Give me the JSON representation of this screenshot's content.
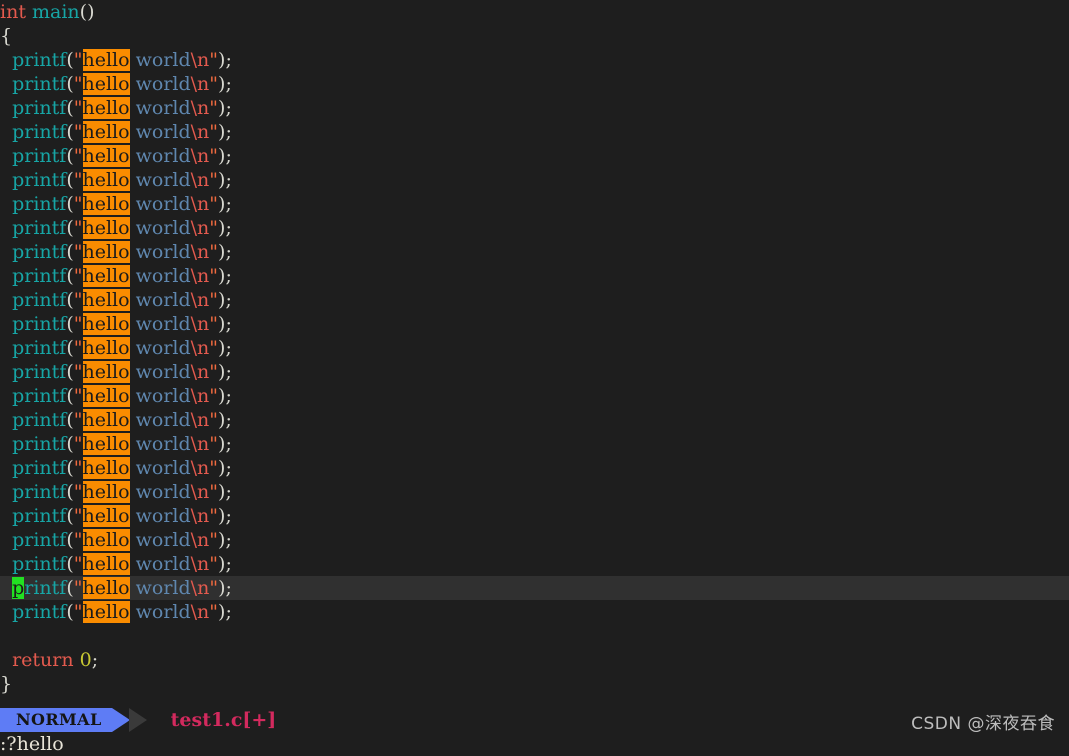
{
  "editor": {
    "name": "vim",
    "background": "#1e1e1e",
    "cursorline_background": "#303030",
    "search_highlight_color": "#fa8c00",
    "cursor_color": "#22e022",
    "line_height_px": 24,
    "font_size_px": 19,
    "search_term": "hello",
    "cursor_line_index": 24,
    "cursor_char": "p",
    "code": {
      "signature": {
        "type": "int",
        "space": " ",
        "name": "main",
        "parens": "()"
      },
      "open_brace": "{",
      "close_brace": "}",
      "printf_line": {
        "indent": "  ",
        "func": "printf",
        "open_paren": "(",
        "open_quote": "\"",
        "hello": "hello",
        "space": " ",
        "world": "world",
        "escape": "\\n",
        "close_quote": "\"",
        "close_paren": ")",
        "semicolon": ";"
      },
      "printf_count": 24,
      "return_line": {
        "indent": "  ",
        "keyword": "return",
        "space": " ",
        "value": "0",
        "semicolon": ";"
      },
      "blank_line": ""
    }
  },
  "statusline": {
    "mode": "NORMAL",
    "mode_bg": "#5e7cf5",
    "filename": "test1.c[+]",
    "filename_color": "#d32a5e"
  },
  "cmdline": {
    "text": ":?hello"
  },
  "watermark": {
    "text": "CSDN @深夜吞食"
  }
}
